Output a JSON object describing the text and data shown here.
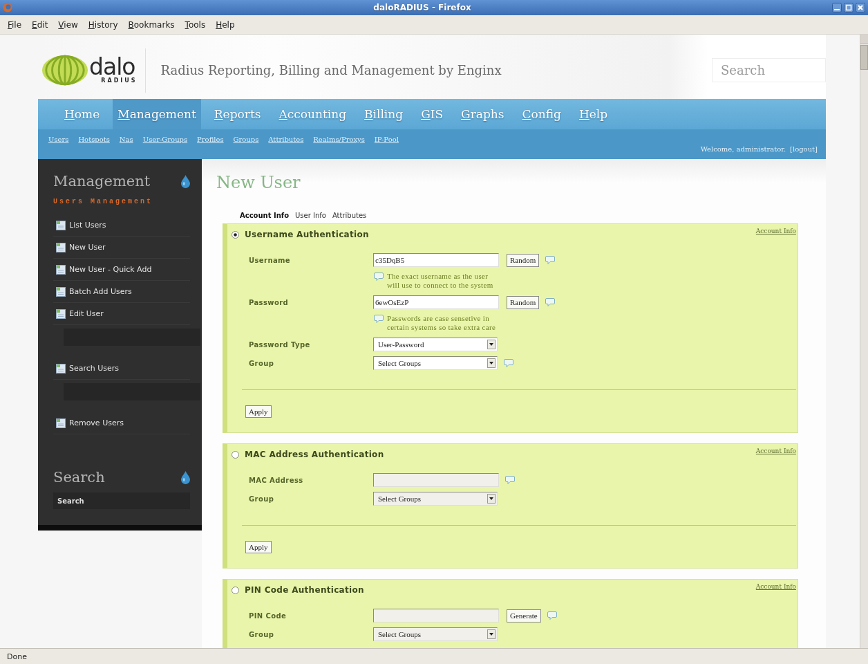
{
  "window": {
    "title": "daloRADIUS - Firefox"
  },
  "menu_bar": [
    "File",
    "Edit",
    "View",
    "History",
    "Bookmarks",
    "Tools",
    "Help"
  ],
  "header": {
    "logo": {
      "name": "dalo",
      "sub": "RADIUS"
    },
    "tagline": "Radius Reporting, Billing and Management by Enginx",
    "search": {
      "placeholder": "Search"
    }
  },
  "nav": {
    "tabs": [
      {
        "label": "Home",
        "selected": false
      },
      {
        "label": "Management",
        "selected": true
      },
      {
        "label": "Reports",
        "selected": false
      },
      {
        "label": "Accounting",
        "selected": false
      },
      {
        "label": "Billing",
        "selected": false
      },
      {
        "label": "GIS",
        "selected": false
      },
      {
        "label": "Graphs",
        "selected": false
      },
      {
        "label": "Config",
        "selected": false
      },
      {
        "label": "Help",
        "selected": false
      }
    ],
    "subtabs": [
      "Users",
      "Hotspots",
      "Nas",
      "User-Groups",
      "Profiles",
      "Groups",
      "Attributes",
      "Realms/Proxys",
      "IP-Pool"
    ],
    "welcome": "Welcome, administrator.",
    "logout": "[logout]"
  },
  "sidebar": {
    "sections": [
      {
        "title": "Management",
        "subtitle": "Users Management",
        "items": [
          {
            "kind": "link",
            "label": "List Users"
          },
          {
            "kind": "link",
            "label": "New User"
          },
          {
            "kind": "link",
            "label": "New User - Quick Add"
          },
          {
            "kind": "link",
            "label": "Batch Add Users"
          },
          {
            "kind": "link",
            "label": "Edit User"
          },
          {
            "kind": "field"
          },
          {
            "kind": "link",
            "label": "Search Users"
          },
          {
            "kind": "field"
          },
          {
            "kind": "link",
            "label": "Remove Users"
          }
        ]
      },
      {
        "title": "Search",
        "search": {
          "value": "Search"
        }
      }
    ]
  },
  "main": {
    "title": "New User",
    "tabs": [
      {
        "label": "Account Info",
        "selected": true
      },
      {
        "label": "User Info",
        "selected": false
      },
      {
        "label": "Attributes",
        "selected": false
      }
    ],
    "fieldsets": [
      {
        "legend": "Username Authentication",
        "selected": true,
        "link": "Account Info",
        "rows": [
          {
            "kind": "text",
            "label": "Username",
            "value": "c35DqB5",
            "button": "Random",
            "tip": true
          },
          {
            "kind": "hint",
            "lines": [
              "The exact username as the user",
              "will use to connect to the system"
            ]
          },
          {
            "kind": "text",
            "label": "Password",
            "value": "6ewOsEzP",
            "button": "Random",
            "tip": true
          },
          {
            "kind": "hint",
            "lines": [
              "Passwords are case sensetive in",
              "certain systems so take extra care"
            ]
          },
          {
            "kind": "select",
            "label": "Password Type",
            "value": "User-Password",
            "tip": false
          },
          {
            "kind": "select",
            "label": "Group",
            "value": "Select Groups",
            "tip": true
          }
        ],
        "button": "Apply"
      },
      {
        "legend": "MAC Address Authentication",
        "selected": false,
        "link": "Account Info",
        "rows": [
          {
            "kind": "text",
            "label": "MAC Address",
            "tip": true
          },
          {
            "kind": "select",
            "label": "Group",
            "value": "Select Groups",
            "tip": false
          }
        ],
        "button": "Apply"
      },
      {
        "legend": "PIN Code Authentication",
        "selected": false,
        "link": "Account Info",
        "rows": [
          {
            "kind": "text",
            "label": "PIN Code",
            "button": "Generate",
            "tip": true
          },
          {
            "kind": "select",
            "label": "Group",
            "value": "Select Groups",
            "tip": false
          }
        ]
      }
    ]
  },
  "status_bar": {
    "text": "Done"
  }
}
